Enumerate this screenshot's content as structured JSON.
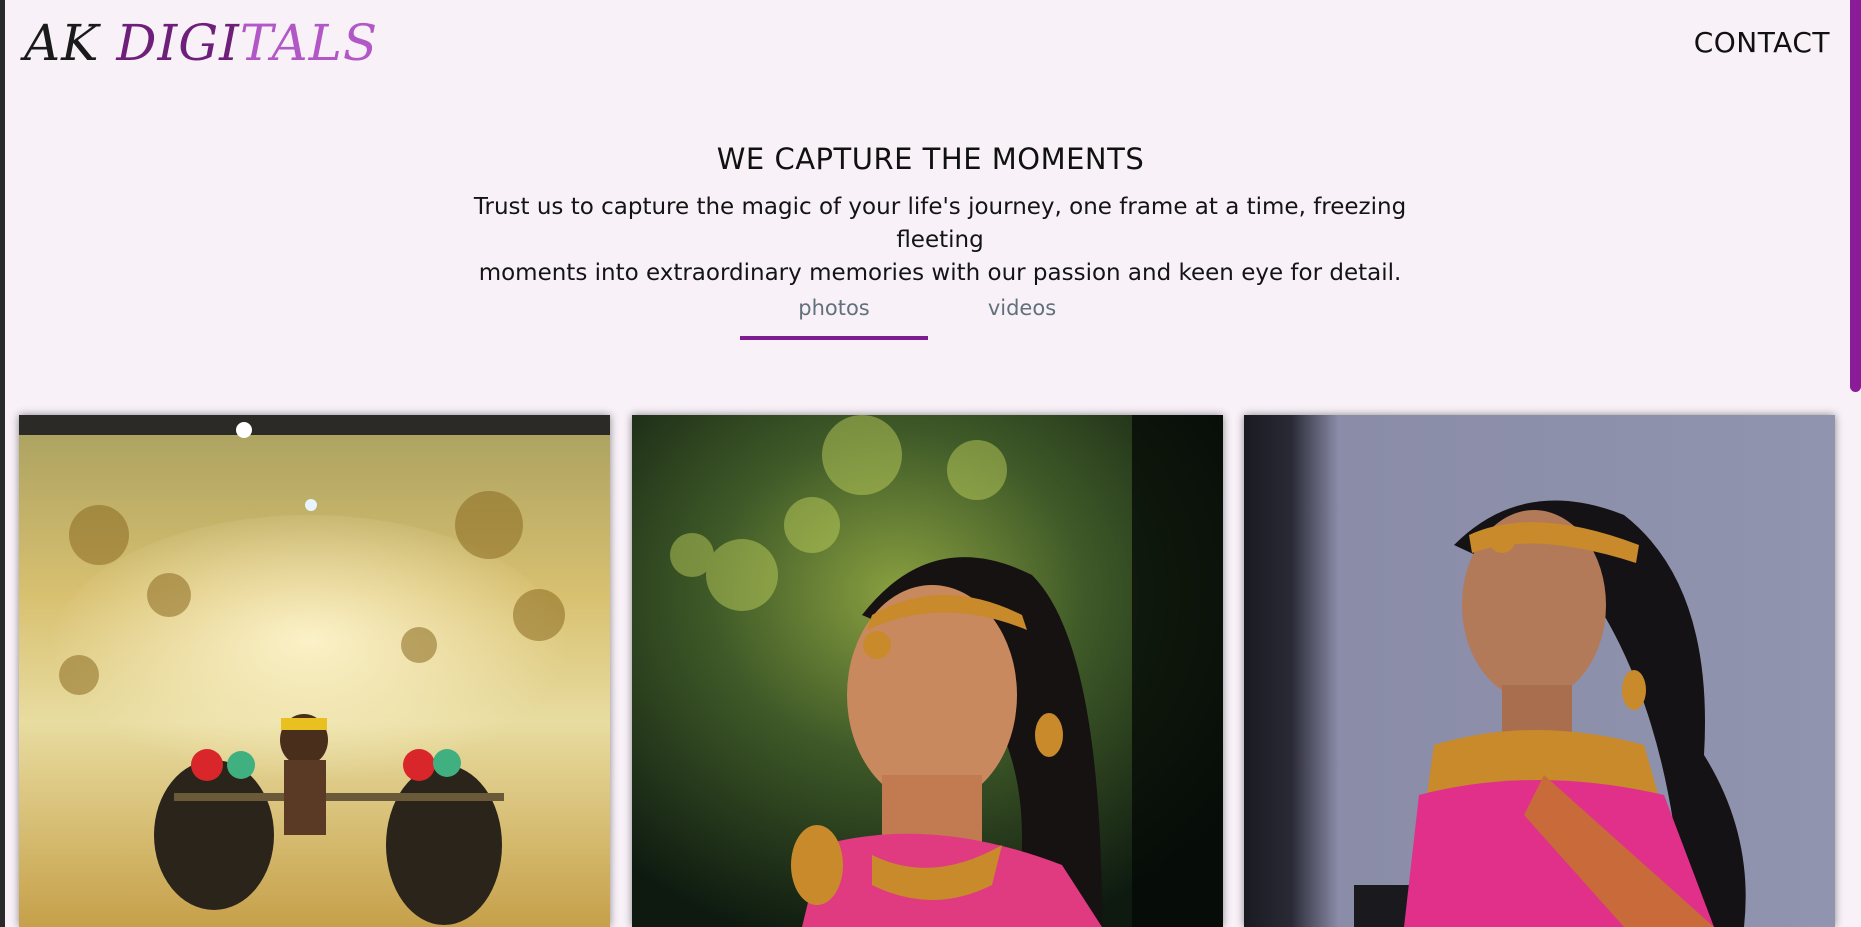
{
  "brand": {
    "part1": "AK ",
    "part2": "DIGI",
    "part3": "TALS"
  },
  "nav": {
    "contact_label": "CONTACT"
  },
  "hero": {
    "title": "WE CAPTURE THE MOMENTS",
    "subtitle_line1": "Trust us to capture the magic of your life's journey, one frame at a time, freezing fleeting",
    "subtitle_line2": "moments into extraordinary memories with our passion and keen eye for detail."
  },
  "tabs": [
    {
      "label": "photos",
      "active": true
    },
    {
      "label": "videos",
      "active": false
    }
  ],
  "gallery": [
    {
      "subject": "buffalo race through muddy water splash"
    },
    {
      "subject": "smiling woman in traditional gold jewellery and pink saree, green bokeh background"
    },
    {
      "subject": "woman in traditional gold jewellery and pink saree, grey background"
    }
  ],
  "colors": {
    "accent": "#7e1d8f",
    "background": "#f8f2f8",
    "tab_text": "#62707c"
  }
}
